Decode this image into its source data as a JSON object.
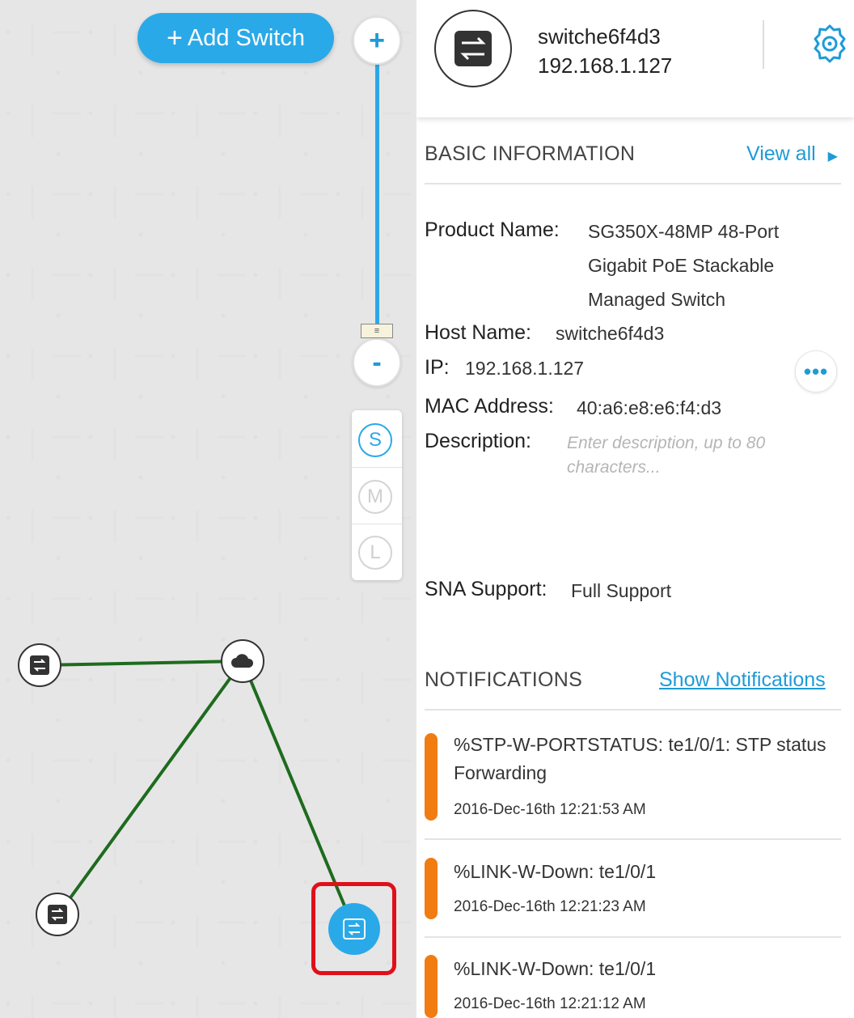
{
  "canvas": {
    "add_switch_label": "Add Switch",
    "add_switch_icon": "+",
    "zoom_in_label": "+",
    "zoom_out_label": "-",
    "size_options": [
      "S",
      "M",
      "L"
    ],
    "size_selected": "S"
  },
  "device": {
    "name": "switche6f4d3",
    "ip": "192.168.1.127"
  },
  "basic_info": {
    "title": "BASIC INFORMATION",
    "view_all": "View all",
    "product_name_label": "Product Name:",
    "product_name_lines": [
      "SG350X-48MP 48-Port",
      "Gigabit PoE Stackable",
      "Managed Switch"
    ],
    "host_name_label": "Host Name:",
    "host_name": "switche6f4d3",
    "ip_label": "IP:",
    "ip": "192.168.1.127",
    "more_label": "•••",
    "mac_label": "MAC Address:",
    "mac": "40:a6:e8:e6:f4:d3",
    "description_label": "Description:",
    "description_placeholder": "Enter description, up to 80 characters...",
    "sna_label": "SNA Support:",
    "sna_value": "Full Support"
  },
  "notifications": {
    "title": "NOTIFICATIONS",
    "show_link": "Show Notifications",
    "items": [
      {
        "message": "%STP-W-PORTSTATUS: te1/0/1: STP status Forwarding",
        "time": "2016-Dec-16th 12:21:53 AM"
      },
      {
        "message": "%LINK-W-Down: te1/0/1",
        "time": "2016-Dec-16th 12:21:23 AM"
      },
      {
        "message": "%LINK-W-Down: te1/0/1",
        "time": "2016-Dec-16th 12:21:12 AM"
      }
    ]
  },
  "colors": {
    "accent": "#2aa9e8",
    "link_line": "#1e6b1e",
    "highlight": "#e0101a",
    "notification_bar": "#f07c12"
  },
  "icons": {
    "gear": "gear-icon",
    "switch": "switch-icon",
    "cloud": "cloud-icon",
    "arrow": "caret-right-icon"
  }
}
